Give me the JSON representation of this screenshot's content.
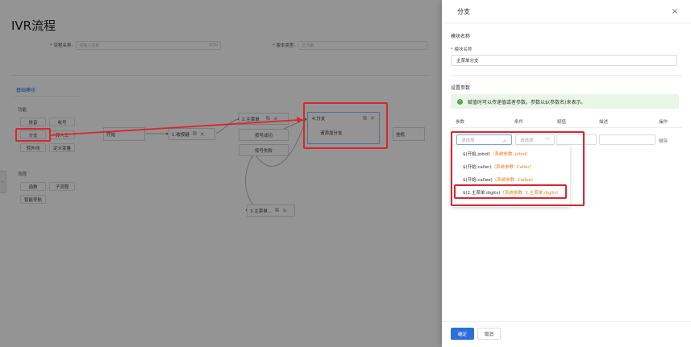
{
  "page": {
    "title": "IVR流程",
    "form": {
      "flow_name_label": "流程名称:",
      "flow_name_placeholder": "请输入名称",
      "flow_name_count": "0/50",
      "version_label": "版本类型:",
      "version_value": "正式版"
    }
  },
  "palette": {
    "tab": "基础模块",
    "sections": [
      {
        "title": "功能",
        "items": [
          "放音",
          "收号",
          "分支",
          "转人工",
          "转外线",
          "定义变量"
        ]
      },
      {
        "title": "流程",
        "items": [
          "函数",
          "子流程",
          "智能导航"
        ]
      }
    ]
  },
  "canvas": {
    "start": "开始",
    "node1": "1.收按键",
    "node2": "2.主菜单",
    "node2_sub": [
      "按号成功",
      "按号失败"
    ],
    "node3": "3.主菜单...",
    "node4": "4.分支",
    "node4_sub": "请添加分支",
    "hangup": "挂机"
  },
  "drawer": {
    "title": "分支",
    "module_name_section": "模块名称",
    "module_name_label": "模块名称",
    "module_name_value": "主菜单分支",
    "params_section": "设置参数",
    "alert": "赋值时可以传递值或者参数。参数以$(参数名)来表示。",
    "columns": [
      "参数",
      "条件",
      "赋值",
      "描述",
      "操作"
    ],
    "param_placeholder": "请选择",
    "condition_placeholder": "请选择",
    "delete_label": "删除",
    "options": [
      {
        "main": "$(开始.jobid)",
        "sys": "（系统参数: Jobid）"
      },
      {
        "main": "$(开始.caller)",
        "sys": "（系统参数: Caller）"
      },
      {
        "main": "$(开始.callee)",
        "sys": "（系统参数: Callee）"
      },
      {
        "main": "$(2.主菜单.digits)",
        "sys": "（系统参数: 2.主菜单.digits）"
      }
    ],
    "confirm_label": "确定",
    "cancel_label": "取消"
  },
  "colors": {
    "primary": "#2c6fd8",
    "annotation": "#d8262f",
    "system_param": "#e67e22",
    "success": "#52a447"
  }
}
